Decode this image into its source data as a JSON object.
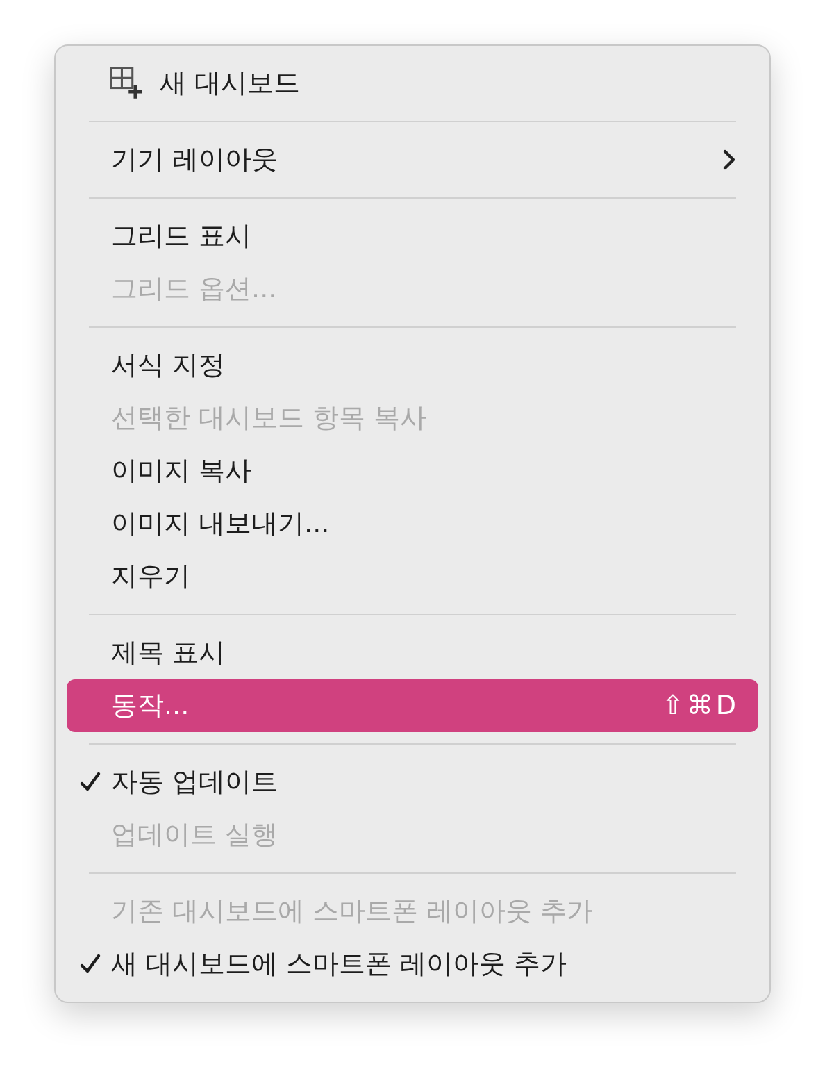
{
  "menu": {
    "sections": [
      {
        "items": [
          {
            "label": "새 대시보드",
            "icon": true,
            "disabled": false,
            "checked": false,
            "selected": false,
            "submenu": false
          }
        ]
      },
      {
        "items": [
          {
            "label": "기기 레이아웃",
            "icon": false,
            "disabled": false,
            "checked": false,
            "selected": false,
            "submenu": true
          }
        ]
      },
      {
        "items": [
          {
            "label": "그리드 표시",
            "icon": false,
            "disabled": false,
            "checked": false,
            "selected": false,
            "submenu": false
          },
          {
            "label": "그리드 옵션...",
            "icon": false,
            "disabled": true,
            "checked": false,
            "selected": false,
            "submenu": false
          }
        ]
      },
      {
        "items": [
          {
            "label": "서식 지정",
            "icon": false,
            "disabled": false,
            "checked": false,
            "selected": false,
            "submenu": false
          },
          {
            "label": "선택한 대시보드 항목 복사",
            "icon": false,
            "disabled": true,
            "checked": false,
            "selected": false,
            "submenu": false
          },
          {
            "label": "이미지 복사",
            "icon": false,
            "disabled": false,
            "checked": false,
            "selected": false,
            "submenu": false
          },
          {
            "label": "이미지 내보내기...",
            "icon": false,
            "disabled": false,
            "checked": false,
            "selected": false,
            "submenu": false
          },
          {
            "label": "지우기",
            "icon": false,
            "disabled": false,
            "checked": false,
            "selected": false,
            "submenu": false
          }
        ]
      },
      {
        "items": [
          {
            "label": "제목 표시",
            "icon": false,
            "disabled": false,
            "checked": false,
            "selected": false,
            "submenu": false
          },
          {
            "label": "동작...",
            "icon": false,
            "disabled": false,
            "checked": false,
            "selected": true,
            "submenu": false,
            "shortcut": "⇧⌘D"
          }
        ]
      },
      {
        "items": [
          {
            "label": "자동 업데이트",
            "icon": false,
            "disabled": false,
            "checked": true,
            "selected": false,
            "submenu": false
          },
          {
            "label": "업데이트 실행",
            "icon": false,
            "disabled": true,
            "checked": false,
            "selected": false,
            "submenu": false
          }
        ]
      },
      {
        "items": [
          {
            "label": "기존 대시보드에 스마트폰 레이아웃 추가",
            "icon": false,
            "disabled": true,
            "checked": false,
            "selected": false,
            "submenu": false
          },
          {
            "label": "새 대시보드에 스마트폰 레이아웃 추가",
            "icon": false,
            "disabled": false,
            "checked": true,
            "selected": false,
            "submenu": false
          }
        ]
      }
    ]
  }
}
